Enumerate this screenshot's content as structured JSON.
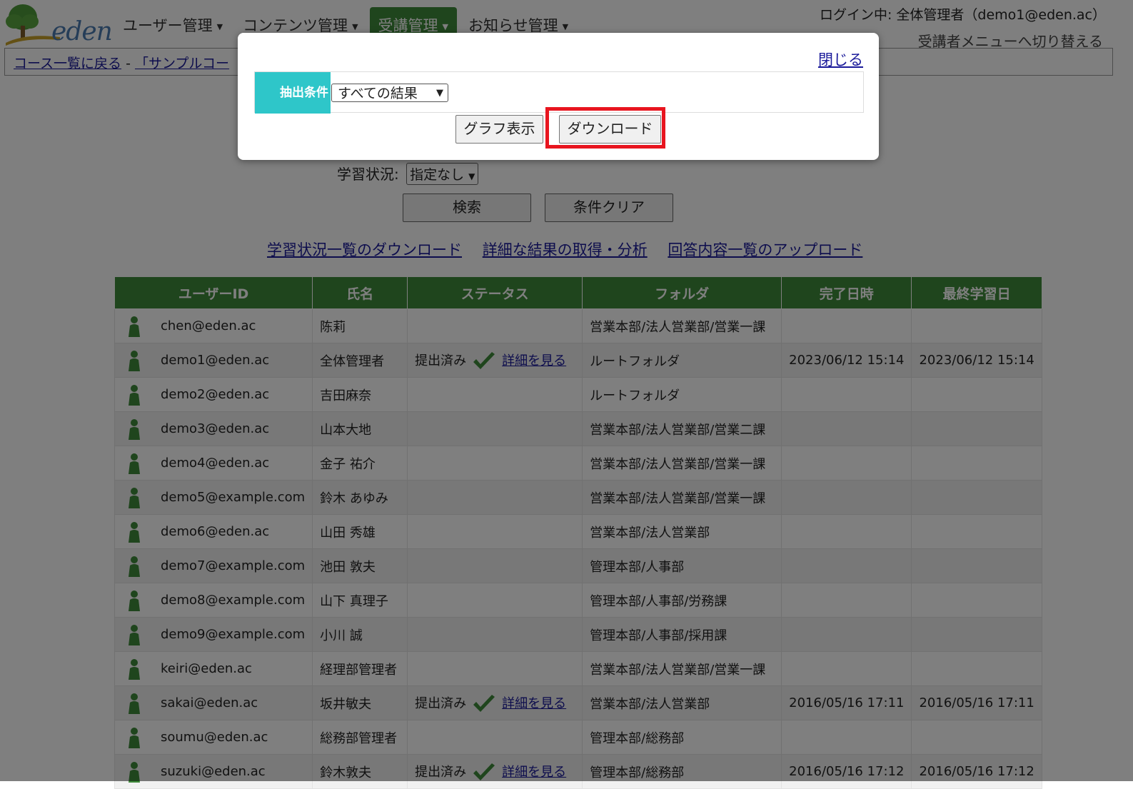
{
  "header": {
    "nav": [
      {
        "label": "ユーザー管理",
        "active": false
      },
      {
        "label": "コンテンツ管理",
        "active": false
      },
      {
        "label": "受講管理",
        "active": true
      },
      {
        "label": "お知らせ管理",
        "active": false
      }
    ],
    "login_info": "ログイン中: 全体管理者（demo1@eden.ac）",
    "switch_menu": "受講者メニューへ切り替える",
    "logo_text": "eden"
  },
  "breadcrumb": {
    "back_link": "コース一覧に戻る",
    "separator": " - ",
    "course_link": "「サンプルコー"
  },
  "search": {
    "status_label": "学習状況:",
    "status_value": "指定なし",
    "search_button": "検索",
    "clear_button": "条件クリア"
  },
  "links": {
    "download_status": "学習状況一覧のダウンロード",
    "detailed_results": "詳細な結果の取得・分析",
    "upload_answers": "回答内容一覧のアップロード"
  },
  "table": {
    "columns": [
      "ユーザーID",
      "氏名",
      "ステータス",
      "フォルダ",
      "完了日時",
      "最終学習日"
    ],
    "rows": [
      {
        "id": "chen@eden.ac",
        "name": "陈莉",
        "status": "",
        "detail": "",
        "folder": "営業本部/法人営業部/営業一課",
        "completed": "",
        "last": ""
      },
      {
        "id": "demo1@eden.ac",
        "name": "全体管理者",
        "status": "提出済み",
        "detail": "詳細を見る",
        "folder": "ルートフォルダ",
        "completed": "2023/06/12 15:14",
        "last": "2023/06/12 15:14"
      },
      {
        "id": "demo2@eden.ac",
        "name": "吉田麻奈",
        "status": "",
        "detail": "",
        "folder": "ルートフォルダ",
        "completed": "",
        "last": ""
      },
      {
        "id": "demo3@eden.ac",
        "name": "山本大地",
        "status": "",
        "detail": "",
        "folder": "営業本部/法人営業部/営業二課",
        "completed": "",
        "last": ""
      },
      {
        "id": "demo4@eden.ac",
        "name": "金子 祐介",
        "status": "",
        "detail": "",
        "folder": "営業本部/法人営業部/営業一課",
        "completed": "",
        "last": ""
      },
      {
        "id": "demo5@example.com",
        "name": "鈴木 あゆみ",
        "status": "",
        "detail": "",
        "folder": "営業本部/法人営業部/営業一課",
        "completed": "",
        "last": ""
      },
      {
        "id": "demo6@eden.ac",
        "name": "山田 秀雄",
        "status": "",
        "detail": "",
        "folder": "営業本部/法人営業部",
        "completed": "",
        "last": ""
      },
      {
        "id": "demo7@example.com",
        "name": "池田 敦夫",
        "status": "",
        "detail": "",
        "folder": "管理本部/人事部",
        "completed": "",
        "last": ""
      },
      {
        "id": "demo8@example.com",
        "name": "山下 真理子",
        "status": "",
        "detail": "",
        "folder": "管理本部/人事部/労務課",
        "completed": "",
        "last": ""
      },
      {
        "id": "demo9@example.com",
        "name": "小川 誠",
        "status": "",
        "detail": "",
        "folder": "管理本部/人事部/採用課",
        "completed": "",
        "last": ""
      },
      {
        "id": "keiri@eden.ac",
        "name": "経理部管理者",
        "status": "",
        "detail": "",
        "folder": "営業本部/法人営業部/営業一課",
        "completed": "",
        "last": ""
      },
      {
        "id": "sakai@eden.ac",
        "name": "坂井敏夫",
        "status": "提出済み",
        "detail": "詳細を見る",
        "folder": "営業本部/法人営業部",
        "completed": "2016/05/16 17:11",
        "last": "2016/05/16 17:11"
      },
      {
        "id": "soumu@eden.ac",
        "name": "総務部管理者",
        "status": "",
        "detail": "",
        "folder": "管理本部/総務部",
        "completed": "",
        "last": ""
      },
      {
        "id": "suzuki@eden.ac",
        "name": "鈴木敦夫",
        "status": "提出済み",
        "detail": "詳細を見る",
        "folder": "管理本部/総務部",
        "completed": "2016/05/16 17:12",
        "last": "2016/05/16 17:12"
      }
    ]
  },
  "modal": {
    "close_link": "閉じる",
    "condition_label": "抽出条件",
    "condition_value": "すべての結果",
    "graph_button": "グラフ表示",
    "download_button": "ダウンロード"
  },
  "colors": {
    "brand_green": "#3f8a3a",
    "condition_cyan": "#2ec6c9",
    "highlight_red": "#e8151f",
    "link_blue": "#1a1a9a"
  }
}
